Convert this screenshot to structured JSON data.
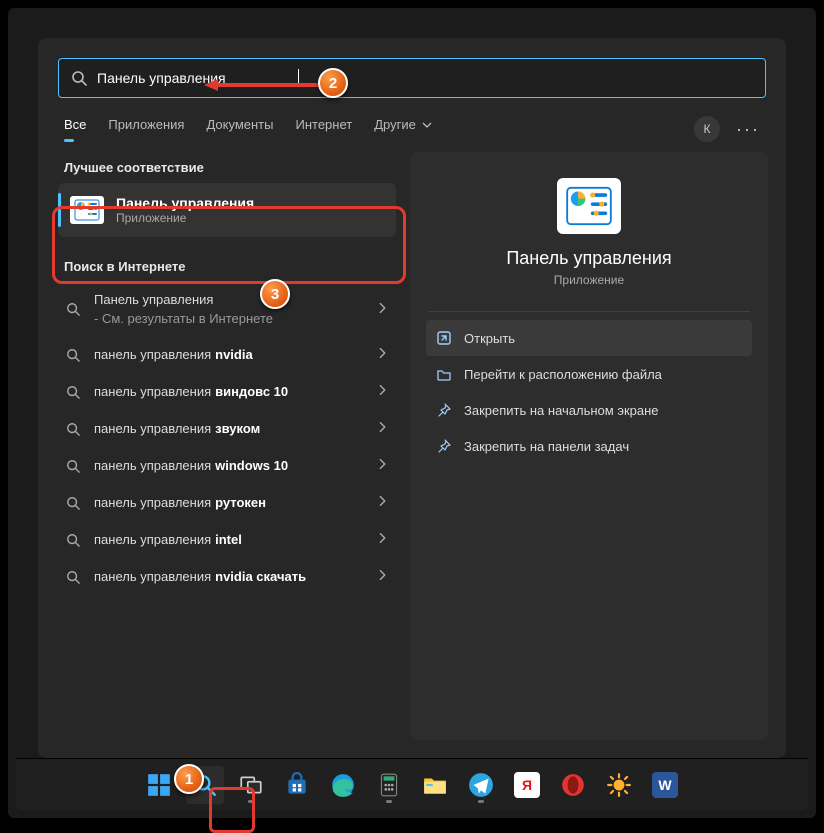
{
  "search": {
    "value": "Панель управления"
  },
  "tabs": {
    "items": [
      {
        "label": "Все",
        "active": true
      },
      {
        "label": "Приложения"
      },
      {
        "label": "Документы"
      },
      {
        "label": "Интернет"
      },
      {
        "label": "Другие"
      }
    ],
    "avatar_initial": "К"
  },
  "sections": {
    "best_match_label": "Лучшее соответствие",
    "web_label": "Поиск в Интернете"
  },
  "best": {
    "title": "Панель управления",
    "subtitle": "Приложение"
  },
  "web_results": [
    {
      "prefix": "Панель управления",
      "suffix": " - См. результаты в Интернете",
      "bold": ""
    },
    {
      "prefix": "панель управления ",
      "bold": "nvidia"
    },
    {
      "prefix": "панель управления ",
      "bold": "виндовс 10"
    },
    {
      "prefix": "панель управления ",
      "bold": "звуком"
    },
    {
      "prefix": "панель управления ",
      "bold": "windows 10"
    },
    {
      "prefix": "панель управления ",
      "bold": "рутокен"
    },
    {
      "prefix": "панель управления ",
      "bold": "intel"
    },
    {
      "prefix": "панель управления ",
      "bold": "nvidia скачать"
    }
  ],
  "details": {
    "title": "Панель управления",
    "subtitle": "Приложение",
    "actions": [
      {
        "icon": "open",
        "label": "Открыть",
        "selected": true
      },
      {
        "icon": "folder",
        "label": "Перейти к расположению файла"
      },
      {
        "icon": "pin",
        "label": "Закрепить на начальном экране"
      },
      {
        "icon": "pin",
        "label": "Закрепить на панели задач"
      }
    ]
  },
  "markers": {
    "m1": "1",
    "m2": "2",
    "m3": "3"
  },
  "taskbar": [
    "start",
    "search",
    "taskview",
    "store",
    "edge",
    "calculator",
    "explorer",
    "telegram",
    "yandex",
    "opera",
    "weather",
    "word"
  ]
}
